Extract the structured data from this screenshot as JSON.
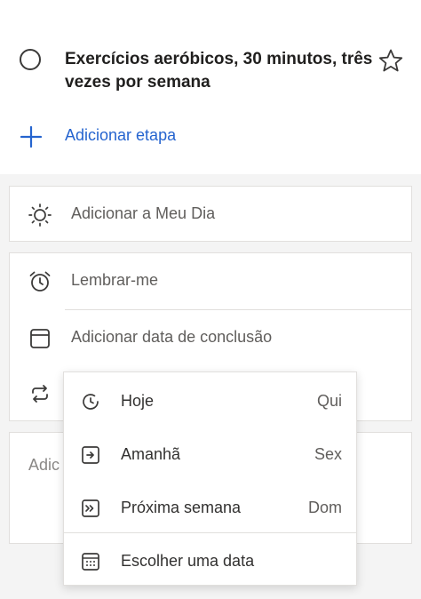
{
  "task": {
    "title": "Exercícios aeróbicos, 30 minutos, três vezes por semana",
    "add_step_label": "Adicionar etapa"
  },
  "actions": {
    "my_day_label": "Adicionar a Meu Dia",
    "remind_label": "Lembrar-me",
    "due_date_label": "Adicionar data de conclusão"
  },
  "note": {
    "placeholder": "Adic"
  },
  "due_menu": {
    "items": [
      {
        "label": "Hoje",
        "day": "Qui",
        "icon": "calendar-today-icon"
      },
      {
        "label": "Amanhã",
        "day": "Sex",
        "icon": "calendar-tomorrow-icon"
      },
      {
        "label": "Próxima semana",
        "day": "Dom",
        "icon": "calendar-next-week-icon"
      }
    ],
    "pick_date_label": "Escolher uma data"
  },
  "colors": {
    "accent": "#2564cf",
    "text": "#323130",
    "muted": "#605e5c",
    "border": "#e1dfdd"
  }
}
